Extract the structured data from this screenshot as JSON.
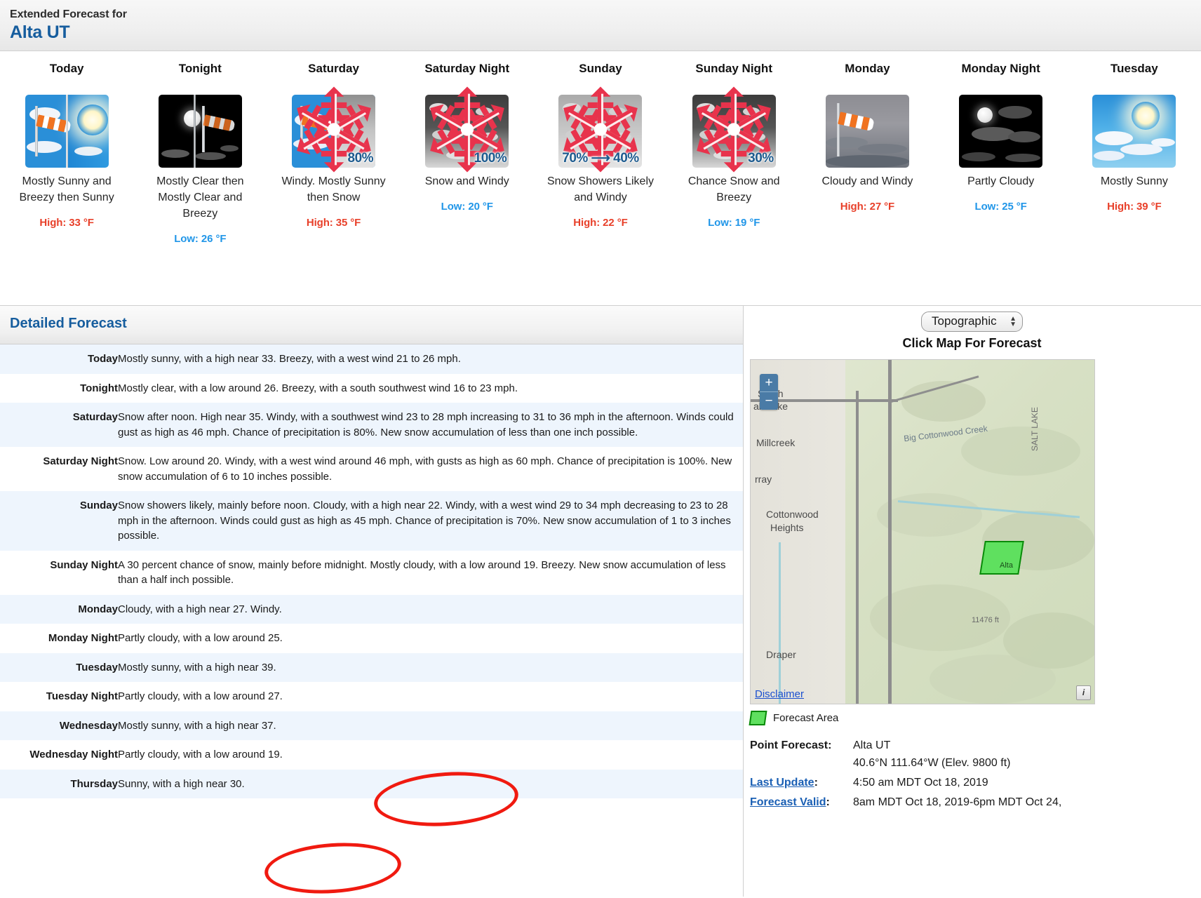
{
  "header": {
    "line1": "Extended Forecast for",
    "location": "Alta UT"
  },
  "forecast_cards": [
    {
      "day": "Today",
      "icon": "windsock-sunny-icon",
      "pop": null,
      "desc": "Mostly Sunny and Breezy then Sunny",
      "temp_type": "High",
      "temp_label": "High: 33 °F"
    },
    {
      "day": "Tonight",
      "icon": "moon-windsock-clear-icon",
      "pop": null,
      "desc": "Mostly Clear then Mostly Clear and Breezy",
      "temp_type": "Low",
      "temp_label": "Low: 26 °F"
    },
    {
      "day": "Saturday",
      "icon": "snow-wind-icon",
      "pop": "80%",
      "desc": "Windy. Mostly Sunny then Snow",
      "temp_type": "High",
      "temp_label": "High: 35 °F"
    },
    {
      "day": "Saturday Night",
      "icon": "snow-wind-icon",
      "pop": "100%",
      "desc": "Snow and Windy",
      "temp_type": "Low",
      "temp_label": "Low: 20 °F"
    },
    {
      "day": "Sunday",
      "icon": "snow-wind-icon",
      "pop": "70% ⟶ 40%",
      "desc": "Snow Showers Likely and Windy",
      "temp_type": "High",
      "temp_label": "High: 22 °F"
    },
    {
      "day": "Sunday Night",
      "icon": "snow-wind-icon",
      "pop": "30%",
      "desc": "Chance Snow and Breezy",
      "temp_type": "Low",
      "temp_label": "Low: 19 °F"
    },
    {
      "day": "Monday",
      "icon": "windsock-cloudy-icon",
      "pop": null,
      "desc": "Cloudy and Windy",
      "temp_type": "High",
      "temp_label": "High: 27 °F"
    },
    {
      "day": "Monday Night",
      "icon": "moon-partly-cloudy-icon",
      "pop": null,
      "desc": "Partly Cloudy",
      "temp_type": "Low",
      "temp_label": "Low: 25 °F"
    },
    {
      "day": "Tuesday",
      "icon": "sunny-icon",
      "pop": null,
      "desc": "Mostly Sunny",
      "temp_type": "High",
      "temp_label": "High: 39 °F"
    }
  ],
  "detailed": {
    "title": "Detailed Forecast",
    "rows": [
      {
        "label": "Today",
        "text": "Mostly sunny, with a high near 33. Breezy, with a west wind 21 to 26 mph."
      },
      {
        "label": "Tonight",
        "text": "Mostly clear, with a low around 26. Breezy, with a south southwest wind 16 to 23 mph."
      },
      {
        "label": "Saturday",
        "text": "Snow after noon. High near 35. Windy, with a southwest wind 23 to 28 mph increasing to 31 to 36 mph in the afternoon. Winds could gust as high as 46 mph. Chance of precipitation is 80%. New snow accumulation of less than one inch possible."
      },
      {
        "label": "Saturday Night",
        "text": "Snow. Low around 20. Windy, with a west wind around 46 mph, with gusts as high as 60 mph. Chance of precipitation is 100%. New snow accumulation of 6 to 10 inches possible."
      },
      {
        "label": "Sunday",
        "text": "Snow showers likely, mainly before noon. Cloudy, with a high near 22. Windy, with a west wind 29 to 34 mph decreasing to 23 to 28 mph in the afternoon. Winds could gust as high as 45 mph. Chance of precipitation is 70%. New snow accumulation of 1 to 3 inches possible."
      },
      {
        "label": "Sunday Night",
        "text": "A 30 percent chance of snow, mainly before midnight. Mostly cloudy, with a low around 19. Breezy. New snow accumulation of less than a half inch possible."
      },
      {
        "label": "Monday",
        "text": "Cloudy, with a high near 27. Windy."
      },
      {
        "label": "Monday Night",
        "text": "Partly cloudy, with a low around 25."
      },
      {
        "label": "Tuesday",
        "text": "Mostly sunny, with a high near 39."
      },
      {
        "label": "Tuesday Night",
        "text": "Partly cloudy, with a low around 27."
      },
      {
        "label": "Wednesday",
        "text": "Mostly sunny, with a high near 37."
      },
      {
        "label": "Wednesday Night",
        "text": "Partly cloudy, with a low around 19."
      },
      {
        "label": "Thursday",
        "text": "Sunny, with a high near 30."
      }
    ]
  },
  "map": {
    "maptype_selected": "Topographic",
    "maptype_options": [
      "Topographic"
    ],
    "click_prompt": "Click Map For Forecast",
    "zoom_in": "+",
    "zoom_out": "−",
    "disclaimer": "Disclaimer",
    "info": "i",
    "legend_label": "Forecast Area",
    "city_labels": [
      "South",
      "alt Lake",
      "Millcreek",
      "rray",
      "Cottonwood",
      "Heights",
      "Draper"
    ],
    "feature_labels": [
      "SALT LAKE",
      "Big Cottonwood Creek",
      "11476 ft",
      "Alta"
    ]
  },
  "meta": {
    "point_forecast_key": "Point Forecast:",
    "point_forecast_value": "Alta UT",
    "coords": "40.6°N 111.64°W (Elev. 9800 ft)",
    "last_update_key": "Last Update",
    "last_update_value": "4:50 am MDT Oct 18, 2019",
    "forecast_valid_key": "Forecast Valid",
    "forecast_valid_value": "8am MDT Oct 18, 2019-6pm MDT Oct 24,"
  },
  "colors": {
    "link_blue": "#165d9e",
    "high_red": "#e8402a",
    "low_blue": "#2196e8",
    "annotation_red": "#f01a10",
    "forecast_area_green": "#5fe05f"
  }
}
